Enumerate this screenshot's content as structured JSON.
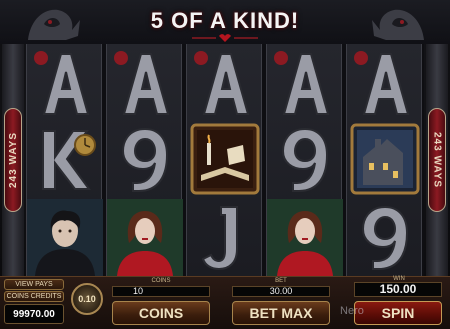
{
  "header": {
    "win_banner": "5 OF A KIND!"
  },
  "side_badges": {
    "left": "243 WAYS",
    "right": "243 WAYS"
  },
  "reels": [
    {
      "symbols": [
        "A",
        "K",
        "vampire-man"
      ]
    },
    {
      "symbols": [
        "A",
        "9",
        "vampire-woman"
      ]
    },
    {
      "symbols": [
        "A",
        "book-scatter",
        "J"
      ]
    },
    {
      "symbols": [
        "A",
        "9",
        "vampire-woman"
      ]
    },
    {
      "symbols": [
        "A",
        "mansion",
        "9"
      ]
    }
  ],
  "panel": {
    "view_pays": "VIEW PAYS",
    "coins_credits": "COINS CREDITS",
    "balance": "99970.00",
    "coin_dial": "0.10",
    "coins_label": "COINS",
    "coins_value": "10",
    "bet_label": "BET",
    "bet_value": "30.00",
    "win_label": "WIN",
    "win_value": "150.00",
    "coins_button": "COINS",
    "betmax_button": "BET MAX",
    "spin_button": "SPIN",
    "watermark": "Nero"
  },
  "colors": {
    "accent_red": "#a1131a",
    "gold_trim": "#a7844c",
    "panel_brown": "#2a1a14"
  }
}
